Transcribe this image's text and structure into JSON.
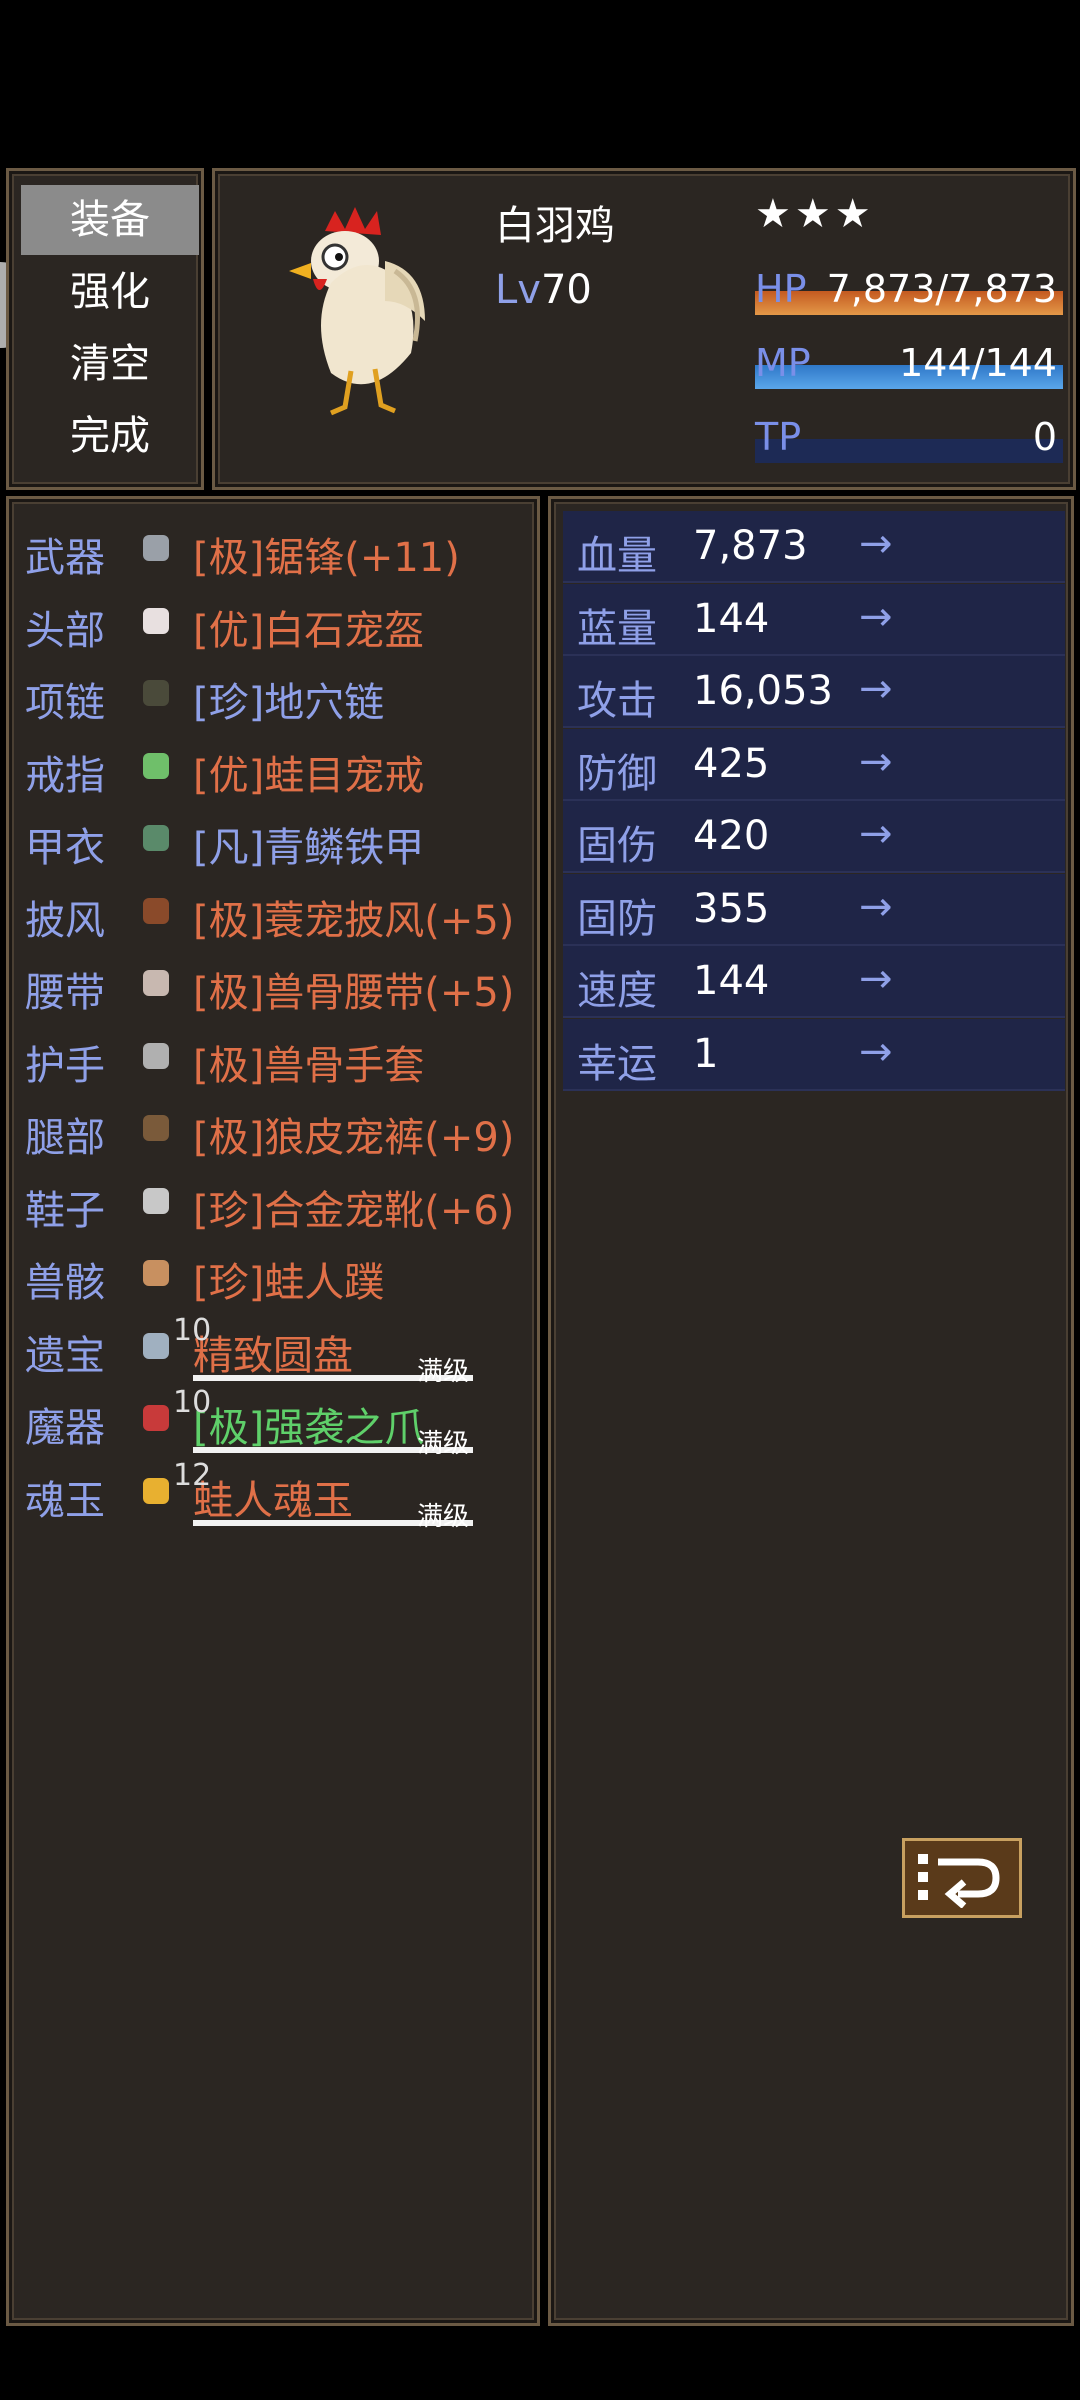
{
  "menu": {
    "items": [
      {
        "label": "装备"
      },
      {
        "label": "强化"
      },
      {
        "label": "清空"
      },
      {
        "label": "完成"
      }
    ]
  },
  "pet": {
    "name": "白羽鸡",
    "stars": "★★★",
    "level_prefix": "Lv",
    "level": "70",
    "hp": {
      "label": "HP",
      "value": "7,873/7,873",
      "fill": 1.0
    },
    "mp": {
      "label": "MP",
      "value": "144/144",
      "fill": 1.0
    },
    "tp": {
      "label": "TP",
      "value": "0",
      "fill": 0.0
    }
  },
  "equipment": [
    {
      "slot": "武器",
      "icon": "sword-icon",
      "name": "[极]锯锋(+11)",
      "quality": "ji"
    },
    {
      "slot": "头部",
      "icon": "helmet-icon",
      "name": "[优]白石宠盔",
      "quality": "you"
    },
    {
      "slot": "项链",
      "icon": "necklace-icon",
      "name": "[珍]地穴链",
      "quality": "zhen"
    },
    {
      "slot": "戒指",
      "icon": "ring-icon",
      "name": "[优]蛙目宠戒",
      "quality": "you"
    },
    {
      "slot": "甲衣",
      "icon": "armor-icon",
      "name": "[凡]青鳞铁甲",
      "quality": "fan"
    },
    {
      "slot": "披风",
      "icon": "cloak-icon",
      "name": "[极]蓑宠披风(+5)",
      "quality": "ji"
    },
    {
      "slot": "腰带",
      "icon": "belt-icon",
      "name": "[极]兽骨腰带(+5)",
      "quality": "ji"
    },
    {
      "slot": "护手",
      "icon": "gauntlet-icon",
      "name": "[极]兽骨手套",
      "quality": "ji"
    },
    {
      "slot": "腿部",
      "icon": "leggings-icon",
      "name": "[极]狼皮宠裤(+9)",
      "quality": "ji"
    },
    {
      "slot": "鞋子",
      "icon": "boots-icon",
      "name": "[珍]合金宠靴(+6)",
      "quality": "ji"
    },
    {
      "slot": "兽骸",
      "icon": "wing-icon",
      "name": "[珍]蛙人蹼",
      "quality": "ji"
    },
    {
      "slot": "遗宝",
      "icon": "disc-icon",
      "name": "精致圆盘",
      "quality": "ji",
      "level": "10",
      "max": "满级"
    },
    {
      "slot": "魔器",
      "icon": "claw-icon",
      "name": "[极]强袭之爪",
      "quality": "green",
      "level": "10",
      "max": "满级"
    },
    {
      "slot": "魂玉",
      "icon": "jade-icon",
      "name": "蛙人魂玉",
      "quality": "ji",
      "level": "12",
      "max": "满级"
    }
  ],
  "stats": [
    {
      "name": "血量",
      "value": "7,873",
      "arrow": "→"
    },
    {
      "name": "蓝量",
      "value": "144",
      "arrow": "→"
    },
    {
      "name": "攻击",
      "value": "16,053",
      "arrow": "→"
    },
    {
      "name": "防御",
      "value": "425",
      "arrow": "→"
    },
    {
      "name": "固伤",
      "value": "420",
      "arrow": "→"
    },
    {
      "name": "固防",
      "value": "355",
      "arrow": "→"
    },
    {
      "name": "速度",
      "value": "144",
      "arrow": "→"
    },
    {
      "name": "幸运",
      "value": "1",
      "arrow": "→"
    }
  ],
  "colors": {
    "quality_ji": "#e07048",
    "quality_zhen": "#8fa0e8",
    "quality_green": "#5fd06a",
    "slot_label": "#8fa0e8",
    "panel_bg": "#2b2622",
    "stat_row_bg": "#1f2547"
  }
}
